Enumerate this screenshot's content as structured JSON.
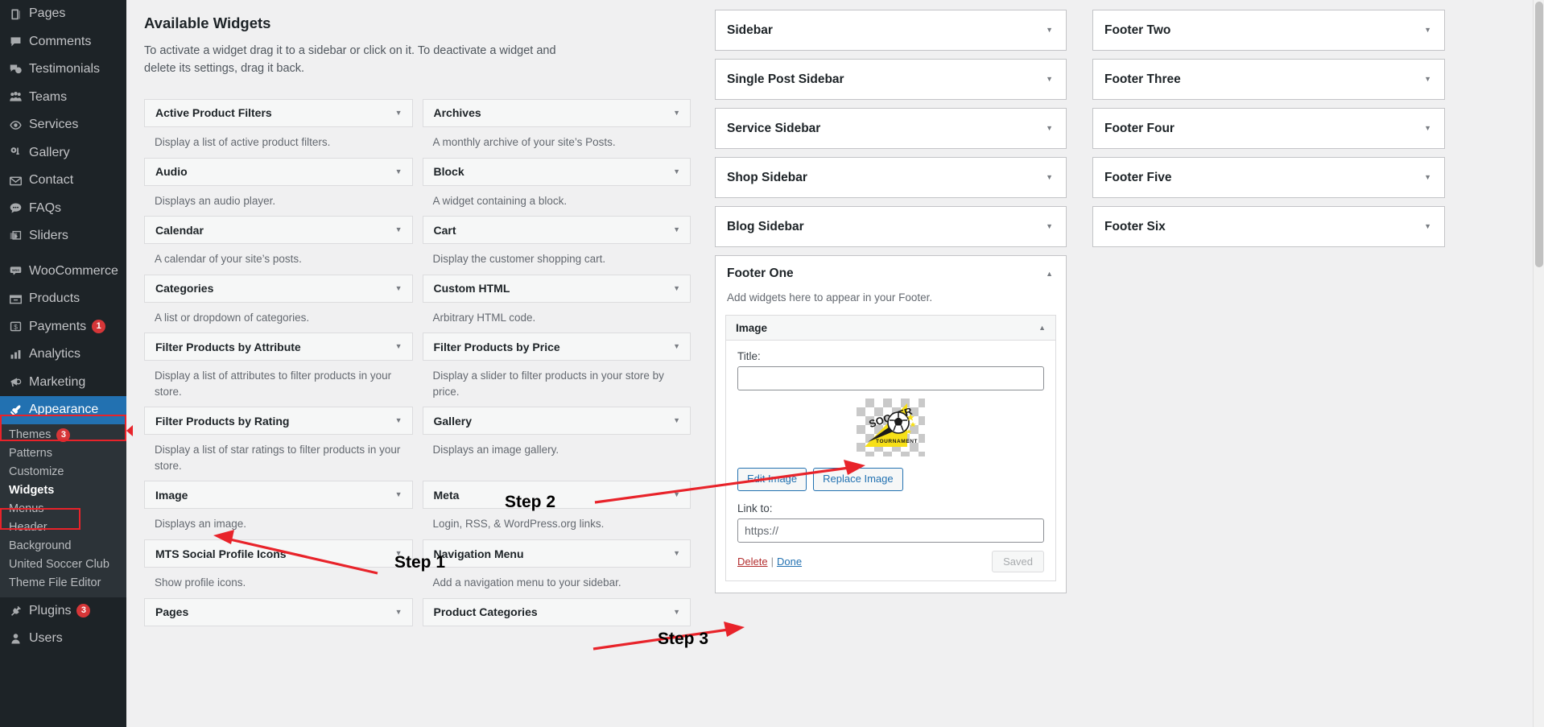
{
  "admin_menu": {
    "items": [
      {
        "label": "Pages",
        "icon": "pages-icon",
        "badge": null
      },
      {
        "label": "Comments",
        "icon": "comments-icon",
        "badge": null
      },
      {
        "label": "Testimonials",
        "icon": "testimonials-icon",
        "badge": null
      },
      {
        "label": "Teams",
        "icon": "teams-icon",
        "badge": null
      },
      {
        "label": "Services",
        "icon": "services-icon",
        "badge": null
      },
      {
        "label": "Gallery",
        "icon": "gallery-icon",
        "badge": null
      },
      {
        "label": "Contact",
        "icon": "contact-icon",
        "badge": null
      },
      {
        "label": "FAQs",
        "icon": "faqs-icon",
        "badge": null
      },
      {
        "label": "Sliders",
        "icon": "sliders-icon",
        "badge": null
      },
      {
        "label": "WooCommerce",
        "icon": "woocommerce-icon",
        "badge": null
      },
      {
        "label": "Products",
        "icon": "products-icon",
        "badge": null
      },
      {
        "label": "Payments",
        "icon": "payments-icon",
        "badge": "1"
      },
      {
        "label": "Analytics",
        "icon": "analytics-icon",
        "badge": null
      },
      {
        "label": "Marketing",
        "icon": "marketing-icon",
        "badge": null
      },
      {
        "label": "Appearance",
        "icon": "appearance-icon",
        "badge": null
      },
      {
        "label": "Plugins",
        "icon": "plugins-icon",
        "badge": "3"
      },
      {
        "label": "Users",
        "icon": "users-icon",
        "badge": null
      }
    ],
    "appearance_submenu": [
      {
        "label": "Themes",
        "badge": "3",
        "current": false
      },
      {
        "label": "Patterns",
        "badge": null,
        "current": false
      },
      {
        "label": "Customize",
        "badge": null,
        "current": false
      },
      {
        "label": "Widgets",
        "badge": null,
        "current": true
      },
      {
        "label": "Menus",
        "badge": null,
        "current": false
      },
      {
        "label": "Header",
        "badge": null,
        "current": false
      },
      {
        "label": "Background",
        "badge": null,
        "current": false
      },
      {
        "label": "United Soccer Club",
        "badge": null,
        "current": false
      },
      {
        "label": "Theme File Editor",
        "badge": null,
        "current": false
      }
    ],
    "colors": {
      "background": "#1d2327",
      "submenu_background": "#2c3338",
      "current": "#2271b1",
      "badge": "#d63638",
      "highlight": "#e8232a"
    }
  },
  "available_widgets": {
    "heading": "Available Widgets",
    "description": "To activate a widget drag it to a sidebar or click on it. To deactivate a widget and delete its settings, drag it back.",
    "items": [
      {
        "title": "Active Product Filters",
        "desc": "Display a list of active product filters."
      },
      {
        "title": "Archives",
        "desc": "A monthly archive of your site’s Posts."
      },
      {
        "title": "Audio",
        "desc": "Displays an audio player."
      },
      {
        "title": "Block",
        "desc": "A widget containing a block."
      },
      {
        "title": "Calendar",
        "desc": "A calendar of your site’s posts."
      },
      {
        "title": "Cart",
        "desc": "Display the customer shopping cart."
      },
      {
        "title": "Categories",
        "desc": "A list or dropdown of categories."
      },
      {
        "title": "Custom HTML",
        "desc": "Arbitrary HTML code."
      },
      {
        "title": "Filter Products by Attribute",
        "desc": "Display a list of attributes to filter products in your store."
      },
      {
        "title": "Filter Products by Price",
        "desc": "Display a slider to filter products in your store by price."
      },
      {
        "title": "Filter Products by Rating",
        "desc": "Display a list of star ratings to filter products in your store."
      },
      {
        "title": "Gallery",
        "desc": "Displays an image gallery."
      },
      {
        "title": "Image",
        "desc": "Displays an image."
      },
      {
        "title": "Meta",
        "desc": "Login, RSS, & WordPress.org links."
      },
      {
        "title": "MTS Social Profile Icons",
        "desc": "Show profile icons."
      },
      {
        "title": "Navigation Menu",
        "desc": "Add a navigation menu to your sidebar."
      },
      {
        "title": "Pages",
        "desc": ""
      },
      {
        "title": "Product Categories",
        "desc": ""
      }
    ]
  },
  "sidebar_column": {
    "panels": [
      {
        "title": "Sidebar"
      },
      {
        "title": "Single Post Sidebar"
      },
      {
        "title": "Service Sidebar"
      },
      {
        "title": "Shop Sidebar"
      },
      {
        "title": "Blog Sidebar"
      }
    ],
    "open_panel": {
      "title": "Footer One",
      "description": "Add widgets here to appear in your Footer.",
      "widget": {
        "title": "Image",
        "title_label": "Title:",
        "title_value": "",
        "image_alt": "Soccer Tournament logo",
        "image_text_primary": "SOCCER",
        "image_text_secondary": "TOURNAMENT",
        "edit_button": "Edit Image",
        "replace_button": "Replace Image",
        "link_label": "Link to:",
        "link_placeholder": "https://",
        "link_value": "",
        "delete_label": "Delete",
        "done_label": "Done",
        "saved_label": "Saved"
      }
    }
  },
  "footer_column": {
    "panels": [
      {
        "title": "Footer Two"
      },
      {
        "title": "Footer Three"
      },
      {
        "title": "Footer Four"
      },
      {
        "title": "Footer Five"
      },
      {
        "title": "Footer Six"
      }
    ]
  },
  "annotations": [
    {
      "label": "Step 1"
    },
    {
      "label": "Step 2"
    },
    {
      "label": "Step 3"
    }
  ],
  "icons": {
    "caret_down": "▼",
    "caret_up": "▲"
  }
}
